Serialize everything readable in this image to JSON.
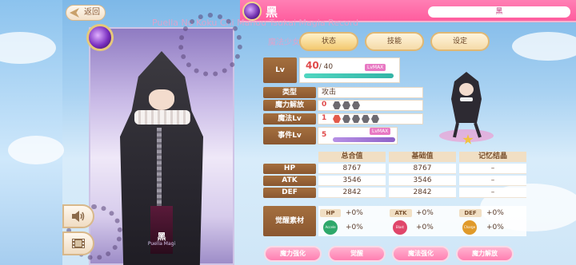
{
  "header": {
    "title": "黑",
    "name_field": "黑"
  },
  "watermark": {
    "line1": "Puella No Koku Chi Mahou Tsukai Magia Record",
    "line2": "魔法少女图鉴"
  },
  "back_button": {
    "label": "返回"
  },
  "card": {
    "name": "黑",
    "subtitle": "Puella Magi"
  },
  "tabs": [
    {
      "label": "状态"
    },
    {
      "label": "技能"
    },
    {
      "label": "设定"
    }
  ],
  "status": {
    "lv_label": "Lv",
    "lv_current": "40",
    "lv_max": "/ 40",
    "lv_badge": "LvMAX",
    "lv_progress": 1.0,
    "type_label": "类型",
    "type_value": "攻击",
    "magia_label": "魔力解放",
    "magia_value": "0",
    "magic_lv_label": "魔法Lv",
    "magic_lv_value": "1",
    "event_lv_label": "事件Lv",
    "event_lv_value": "5",
    "event_badge": "LvMAX",
    "event_progress": 1.0
  },
  "stats": {
    "headers": [
      "总合值",
      "基础值",
      "记忆结晶"
    ],
    "rows": [
      {
        "name": "HP",
        "total": "8767",
        "base": "8767",
        "memoria": "–"
      },
      {
        "name": "ATK",
        "total": "3546",
        "base": "3546",
        "memoria": "–"
      },
      {
        "name": "DEF",
        "total": "2842",
        "base": "2842",
        "memoria": "–"
      }
    ]
  },
  "awakening": {
    "label": "觉醒素材",
    "stats": [
      {
        "name": "HP",
        "value": "+0%"
      },
      {
        "name": "ATK",
        "value": "+0%"
      },
      {
        "name": "DEF",
        "value": "+0%"
      }
    ],
    "materials": [
      {
        "icon": "accele-orb-icon",
        "label": "Accele",
        "value": "+0%",
        "color": "#2ea86a"
      },
      {
        "icon": "blast-orb-icon",
        "label": "Blast",
        "value": "+0%",
        "color": "#e0466a"
      },
      {
        "icon": "charge-orb-icon",
        "label": "Charge",
        "value": "+0%",
        "color": "#e09a2a"
      }
    ]
  },
  "bottom_buttons": [
    {
      "label": "魔力强化"
    },
    {
      "label": "觉醒"
    },
    {
      "label": "魔法强化"
    },
    {
      "label": "魔力解放"
    }
  ],
  "colors": {
    "accent_pink": "#ff6fa8",
    "label_brown": "#9a6636",
    "lv_bar": "#3cc3b0"
  }
}
